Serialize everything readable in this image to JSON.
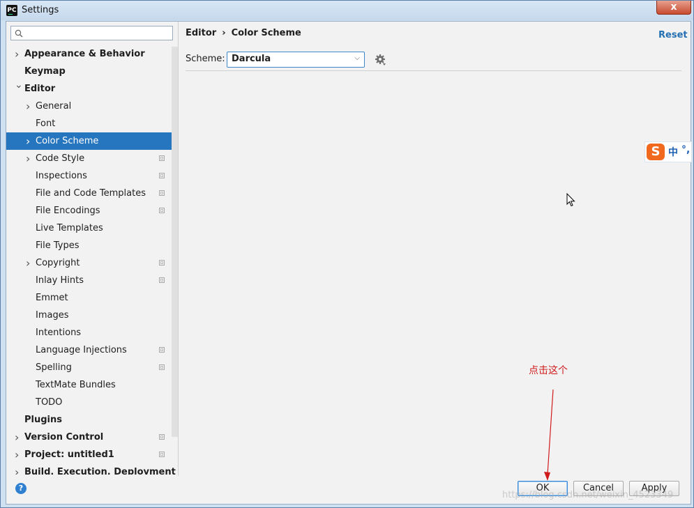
{
  "window": {
    "title": "Settings",
    "app_icon": "PC",
    "close_symbol": "x"
  },
  "search": {
    "placeholder": ""
  },
  "tree": [
    {
      "label": "Appearance & Behavior",
      "bold": true,
      "arrow": "right",
      "indent": 0,
      "copy": false,
      "selected": false
    },
    {
      "label": "Keymap",
      "bold": true,
      "arrow": "none",
      "indent": 0,
      "copy": false,
      "selected": false
    },
    {
      "label": "Editor",
      "bold": true,
      "arrow": "down",
      "indent": 0,
      "copy": false,
      "selected": false
    },
    {
      "label": "General",
      "bold": false,
      "arrow": "right",
      "indent": 1,
      "copy": false,
      "selected": false
    },
    {
      "label": "Font",
      "bold": false,
      "arrow": "none",
      "indent": 1,
      "copy": false,
      "selected": false
    },
    {
      "label": "Color Scheme",
      "bold": false,
      "arrow": "right",
      "indent": 1,
      "copy": false,
      "selected": true
    },
    {
      "label": "Code Style",
      "bold": false,
      "arrow": "right",
      "indent": 1,
      "copy": true,
      "selected": false
    },
    {
      "label": "Inspections",
      "bold": false,
      "arrow": "none",
      "indent": 1,
      "copy": true,
      "selected": false
    },
    {
      "label": "File and Code Templates",
      "bold": false,
      "arrow": "none",
      "indent": 1,
      "copy": true,
      "selected": false
    },
    {
      "label": "File Encodings",
      "bold": false,
      "arrow": "none",
      "indent": 1,
      "copy": true,
      "selected": false
    },
    {
      "label": "Live Templates",
      "bold": false,
      "arrow": "none",
      "indent": 1,
      "copy": false,
      "selected": false
    },
    {
      "label": "File Types",
      "bold": false,
      "arrow": "none",
      "indent": 1,
      "copy": false,
      "selected": false
    },
    {
      "label": "Copyright",
      "bold": false,
      "arrow": "right",
      "indent": 1,
      "copy": true,
      "selected": false
    },
    {
      "label": "Inlay Hints",
      "bold": false,
      "arrow": "none",
      "indent": 1,
      "copy": true,
      "selected": false
    },
    {
      "label": "Emmet",
      "bold": false,
      "arrow": "none",
      "indent": 1,
      "copy": false,
      "selected": false
    },
    {
      "label": "Images",
      "bold": false,
      "arrow": "none",
      "indent": 1,
      "copy": false,
      "selected": false
    },
    {
      "label": "Intentions",
      "bold": false,
      "arrow": "none",
      "indent": 1,
      "copy": false,
      "selected": false
    },
    {
      "label": "Language Injections",
      "bold": false,
      "arrow": "none",
      "indent": 1,
      "copy": true,
      "selected": false
    },
    {
      "label": "Spelling",
      "bold": false,
      "arrow": "none",
      "indent": 1,
      "copy": true,
      "selected": false
    },
    {
      "label": "TextMate Bundles",
      "bold": false,
      "arrow": "none",
      "indent": 1,
      "copy": false,
      "selected": false
    },
    {
      "label": "TODO",
      "bold": false,
      "arrow": "none",
      "indent": 1,
      "copy": false,
      "selected": false
    },
    {
      "label": "Plugins",
      "bold": true,
      "arrow": "none",
      "indent": 0,
      "copy": false,
      "selected": false
    },
    {
      "label": "Version Control",
      "bold": true,
      "arrow": "right",
      "indent": 0,
      "copy": true,
      "selected": false
    },
    {
      "label": "Project: untitled1",
      "bold": true,
      "arrow": "right",
      "indent": 0,
      "copy": true,
      "selected": false
    },
    {
      "label": "Build, Execution, Deployment",
      "bold": true,
      "arrow": "right",
      "indent": 0,
      "copy": false,
      "selected": false
    }
  ],
  "breadcrumb": {
    "parent": "Editor",
    "separator": "›",
    "current": "Color Scheme"
  },
  "reset_label": "Reset",
  "scheme": {
    "label": "Scheme:",
    "value": "Darcula"
  },
  "ime": {
    "logo": "S",
    "lang": "中",
    "punct": "°,"
  },
  "annotation": {
    "text": "点击这个",
    "color": "#d01b1b"
  },
  "buttons": {
    "ok": "OK",
    "cancel": "Cancel",
    "apply": "Apply"
  },
  "help_symbol": "?",
  "watermark": "https://blog.csdn.net/weixin_4523349",
  "colors": {
    "selection": "#2675bf",
    "accent": "#2470b3"
  }
}
